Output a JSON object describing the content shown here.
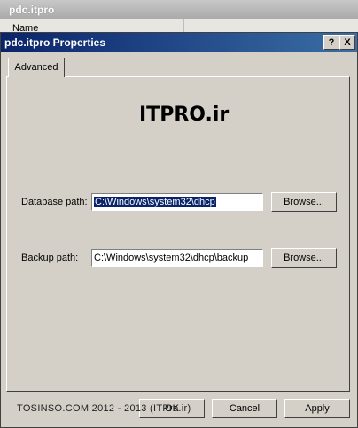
{
  "background_window": {
    "title": "pdc.itpro",
    "column_header": "Name"
  },
  "dialog": {
    "title": "pdc.itpro Properties",
    "help_button": "?",
    "close_button": "X",
    "tabs": [
      {
        "label": "Advanced"
      }
    ],
    "watermark": "ITPRO.ir",
    "database_path": {
      "label": "Database path:",
      "value": "C:\\Windows\\system32\\dhcp",
      "browse": "Browse..."
    },
    "backup_path": {
      "label": "Backup path:",
      "value": "C:\\Windows\\system32\\dhcp\\backup",
      "browse": "Browse..."
    },
    "buttons": {
      "ok": "OK",
      "cancel": "Cancel",
      "apply": "Apply"
    },
    "footer_text": "TOSINSO.COM 2012 - 2013 (ITPro.ir)"
  },
  "colors": {
    "titlebar_start": "#0a246a",
    "titlebar_end": "#3a6ea5",
    "face": "#d4d0c8",
    "selection": "#0a246a"
  }
}
